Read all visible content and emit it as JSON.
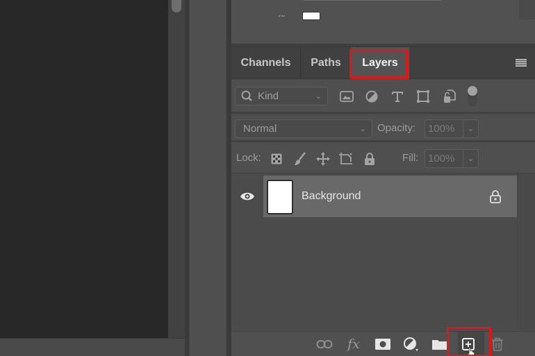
{
  "app": {
    "name": "Photoshop Layers Panel"
  },
  "colors": {
    "highlight": "#ee1111",
    "panel_bg": "#4d4d4d",
    "canvas_bg": "#282828"
  },
  "upper_panel": {
    "label": "ᵖᵀᵉˣ"
  },
  "tabs": [
    {
      "label": "Channels",
      "active": false
    },
    {
      "label": "Paths",
      "active": false
    },
    {
      "label": "Layers",
      "active": true
    }
  ],
  "panel_menu_icon": "hamburger-menu-icon",
  "filter": {
    "kind_label": "Kind",
    "kind_icon": "search-icon",
    "icons": [
      "pixel-layer-filter-icon",
      "adjustment-layer-filter-icon",
      "type-layer-filter-icon",
      "shape-layer-filter-icon",
      "smart-object-filter-icon"
    ],
    "filter_toggle": "on"
  },
  "blend": {
    "mode": "Normal",
    "opacity_label": "Opacity:",
    "opacity_value": "100%"
  },
  "lock": {
    "label": "Lock:",
    "icons": [
      "lock-transparent-pixels-icon",
      "lock-image-pixels-icon",
      "lock-position-icon",
      "lock-artboard-icon",
      "lock-all-icon"
    ],
    "fill_label": "Fill:",
    "fill_value": "100%"
  },
  "layers": [
    {
      "name": "Background",
      "visible": true,
      "locked": true,
      "selected": true
    }
  ],
  "footer": {
    "icons": [
      "link-layers-icon",
      "fx-layer-style-icon",
      "add-mask-icon",
      "adjustment-layer-icon",
      "new-group-icon",
      "new-layer-icon",
      "delete-layer-icon"
    ],
    "fx_label": "fx"
  }
}
